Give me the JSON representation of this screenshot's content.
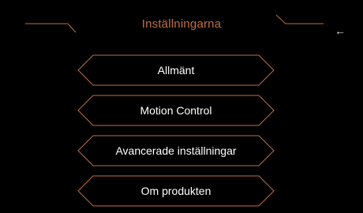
{
  "header": {
    "title": "Inställningarna",
    "back_glyph": "←",
    "back_icon": "back-arrow-icon"
  },
  "menu": {
    "items": [
      {
        "label": "Allmänt"
      },
      {
        "label": "Motion Control"
      },
      {
        "label": "Avancerade inställningar"
      },
      {
        "label": "Om produkten"
      }
    ]
  },
  "colors": {
    "accent": "#c0703e",
    "text": "#ffffff",
    "background": "#000000"
  }
}
